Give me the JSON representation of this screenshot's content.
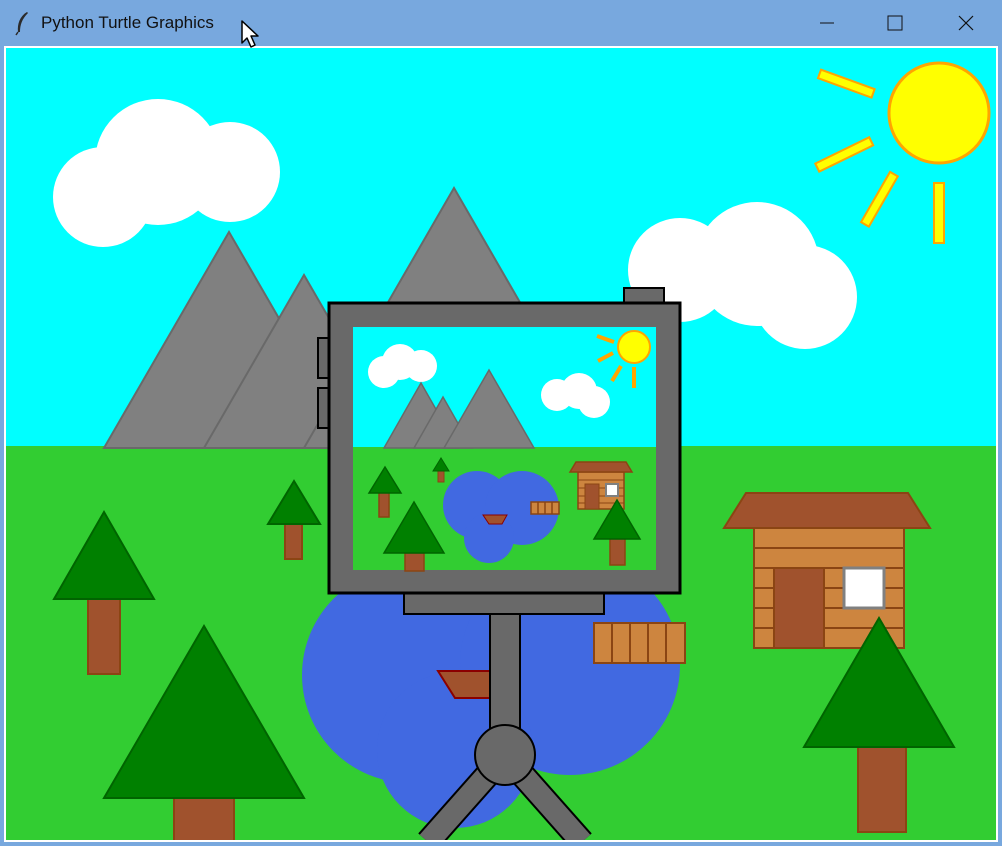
{
  "window": {
    "title": "Python Turtle Graphics",
    "icon": "feather-icon",
    "controls": {
      "minimize": "minimize-icon",
      "maximize": "maximize-icon",
      "close": "close-icon"
    }
  },
  "colors": {
    "titlebar": "#78a8de",
    "sky": "#00ffff",
    "grass": "#32cd32",
    "mountain": "#808080",
    "cloud": "#ffffff",
    "sun": "#ffff00",
    "sun_outline": "#ffa500",
    "tree_leaves": "#008000",
    "trunk": "#a0522d",
    "lake": "#4169e1",
    "cabin_wall": "#cd853f",
    "cabin_roof": "#a0522d",
    "camera_body": "#696969"
  }
}
